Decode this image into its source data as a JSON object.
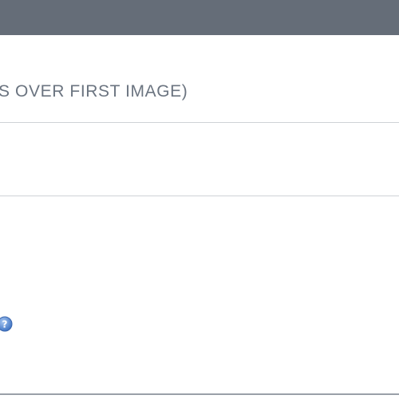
{
  "header": {
    "bar_color": "#656d78"
  },
  "section": {
    "heading": "S OVER FIRST IMAGE)"
  },
  "help": {
    "icon": "question-mark-help-icon",
    "color": "#5b8fd6"
  }
}
